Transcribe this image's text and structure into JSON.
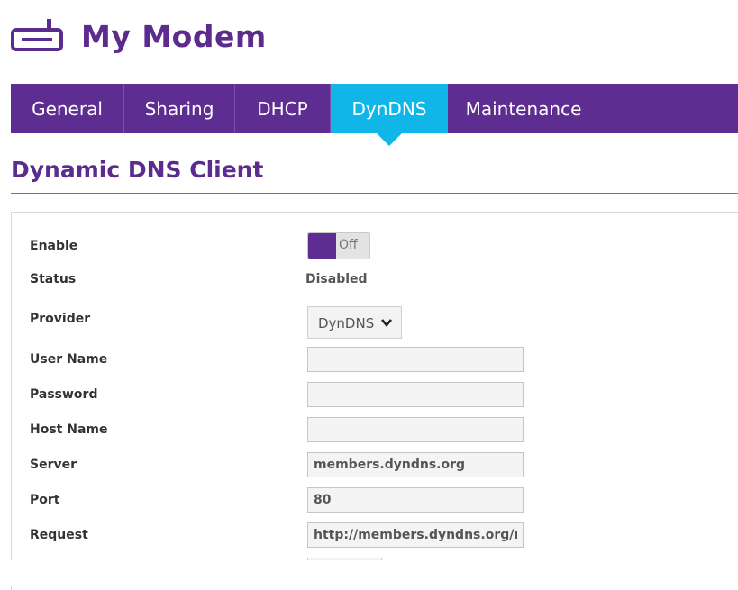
{
  "header": {
    "title": "My Modem",
    "icon": "modem-icon"
  },
  "tabs": [
    {
      "label": "General",
      "active": false
    },
    {
      "label": "Sharing",
      "active": false
    },
    {
      "label": "DHCP",
      "active": false
    },
    {
      "label": "DynDNS",
      "active": true
    },
    {
      "label": "Maintenance",
      "active": false
    }
  ],
  "section": {
    "title": "Dynamic DNS Client"
  },
  "form": {
    "enable": {
      "label": "Enable",
      "toggle_text": "Off",
      "on": false
    },
    "status": {
      "label": "Status",
      "value": "Disabled"
    },
    "provider": {
      "label": "Provider",
      "selected": "DynDNS"
    },
    "username": {
      "label": "User Name",
      "value": ""
    },
    "password": {
      "label": "Password",
      "value": ""
    },
    "hostname": {
      "label": "Host Name",
      "value": ""
    },
    "server": {
      "label": "Server",
      "value": "members.dyndns.org"
    },
    "port": {
      "label": "Port",
      "value": "80"
    },
    "request": {
      "label": "Request",
      "value": "http://members.dyndns.org/nic/update"
    }
  },
  "colors": {
    "brand_purple": "#5e2d91",
    "title_purple": "#5b2c8e",
    "active_tab": "#11b6e8"
  }
}
